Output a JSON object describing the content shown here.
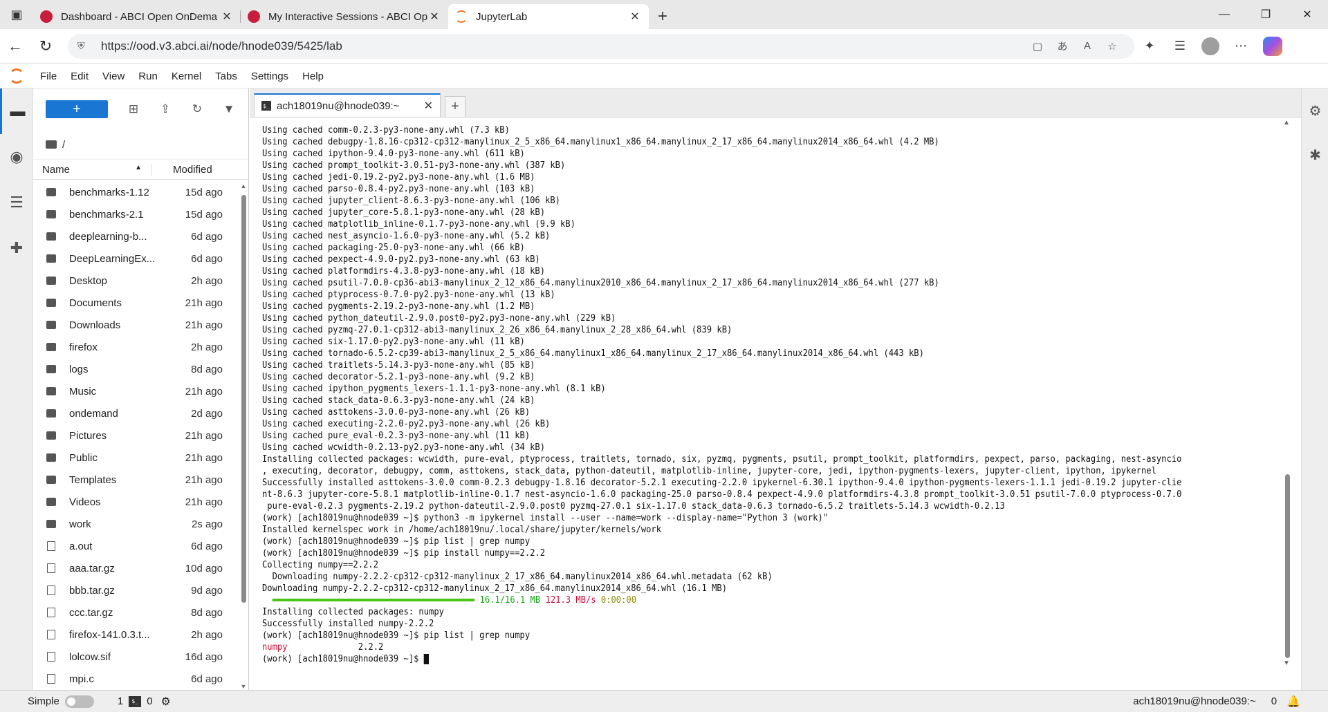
{
  "browser": {
    "tabs": [
      {
        "title": "Dashboard - ABCI Open OnDema",
        "favicon": "abci-logo-icon"
      },
      {
        "title": "My Interactive Sessions - ABCI Op",
        "favicon": "abci-logo-icon"
      },
      {
        "title": "JupyterLab",
        "favicon": "jupyter-logo-icon",
        "active": true
      }
    ],
    "url": "https://ood.v3.abci.ai/node/hnode039/5425/lab"
  },
  "menu": {
    "items": [
      "File",
      "Edit",
      "View",
      "Run",
      "Kernel",
      "Tabs",
      "Settings",
      "Help"
    ]
  },
  "filebrowser": {
    "new_label": "+",
    "crumb": "/",
    "col_name": "Name",
    "col_modified": "Modified",
    "files": [
      {
        "name": "benchmarks-1.12",
        "modified": "15d ago",
        "type": "dir"
      },
      {
        "name": "benchmarks-2.1",
        "modified": "15d ago",
        "type": "dir"
      },
      {
        "name": "deeplearning-b...",
        "modified": "6d ago",
        "type": "dir"
      },
      {
        "name": "DeepLearningEx...",
        "modified": "6d ago",
        "type": "dir"
      },
      {
        "name": "Desktop",
        "modified": "2h ago",
        "type": "dir"
      },
      {
        "name": "Documents",
        "modified": "21h ago",
        "type": "dir"
      },
      {
        "name": "Downloads",
        "modified": "21h ago",
        "type": "dir"
      },
      {
        "name": "firefox",
        "modified": "2h ago",
        "type": "dir"
      },
      {
        "name": "logs",
        "modified": "8d ago",
        "type": "dir"
      },
      {
        "name": "Music",
        "modified": "21h ago",
        "type": "dir"
      },
      {
        "name": "ondemand",
        "modified": "2d ago",
        "type": "dir"
      },
      {
        "name": "Pictures",
        "modified": "21h ago",
        "type": "dir"
      },
      {
        "name": "Public",
        "modified": "21h ago",
        "type": "dir"
      },
      {
        "name": "Templates",
        "modified": "21h ago",
        "type": "dir"
      },
      {
        "name": "Videos",
        "modified": "21h ago",
        "type": "dir"
      },
      {
        "name": "work",
        "modified": "2s ago",
        "type": "dir"
      },
      {
        "name": "a.out",
        "modified": "6d ago",
        "type": "file"
      },
      {
        "name": "aaa.tar.gz",
        "modified": "10d ago",
        "type": "file"
      },
      {
        "name": "bbb.tar.gz",
        "modified": "9d ago",
        "type": "file"
      },
      {
        "name": "ccc.tar.gz",
        "modified": "8d ago",
        "type": "file"
      },
      {
        "name": "firefox-141.0.3.t...",
        "modified": "2h ago",
        "type": "file"
      },
      {
        "name": "lolcow.sif",
        "modified": "16d ago",
        "type": "file"
      },
      {
        "name": "mpi.c",
        "modified": "6d ago",
        "type": "file"
      }
    ]
  },
  "dock": {
    "tab_label": "ach18019nu@hnode039:~",
    "tab_icon": "$_"
  },
  "terminal": {
    "lines": [
      "Using cached comm-0.2.3-py3-none-any.whl (7.3 kB)",
      "Using cached debugpy-1.8.16-cp312-cp312-manylinux_2_5_x86_64.manylinux1_x86_64.manylinux_2_17_x86_64.manylinux2014_x86_64.whl (4.2 MB)",
      "Using cached ipython-9.4.0-py3-none-any.whl (611 kB)",
      "Using cached prompt_toolkit-3.0.51-py3-none-any.whl (387 kB)",
      "Using cached jedi-0.19.2-py2.py3-none-any.whl (1.6 MB)",
      "Using cached parso-0.8.4-py2.py3-none-any.whl (103 kB)",
      "Using cached jupyter_client-8.6.3-py3-none-any.whl (106 kB)",
      "Using cached jupyter_core-5.8.1-py3-none-any.whl (28 kB)",
      "Using cached matplotlib_inline-0.1.7-py3-none-any.whl (9.9 kB)",
      "Using cached nest_asyncio-1.6.0-py3-none-any.whl (5.2 kB)",
      "Using cached packaging-25.0-py3-none-any.whl (66 kB)",
      "Using cached pexpect-4.9.0-py2.py3-none-any.whl (63 kB)",
      "Using cached platformdirs-4.3.8-py3-none-any.whl (18 kB)",
      "Using cached psutil-7.0.0-cp36-abi3-manylinux_2_12_x86_64.manylinux2010_x86_64.manylinux_2_17_x86_64.manylinux2014_x86_64.whl (277 kB)",
      "Using cached ptyprocess-0.7.0-py2.py3-none-any.whl (13 kB)",
      "Using cached pygments-2.19.2-py3-none-any.whl (1.2 MB)",
      "Using cached python_dateutil-2.9.0.post0-py2.py3-none-any.whl (229 kB)",
      "Using cached pyzmq-27.0.1-cp312-abi3-manylinux_2_26_x86_64.manylinux_2_28_x86_64.whl (839 kB)",
      "Using cached six-1.17.0-py2.py3-none-any.whl (11 kB)",
      "Using cached tornado-6.5.2-cp39-abi3-manylinux_2_5_x86_64.manylinux1_x86_64.manylinux_2_17_x86_64.manylinux2014_x86_64.whl (443 kB)",
      "Using cached traitlets-5.14.3-py3-none-any.whl (85 kB)",
      "Using cached decorator-5.2.1-py3-none-any.whl (9.2 kB)",
      "Using cached ipython_pygments_lexers-1.1.1-py3-none-any.whl (8.1 kB)",
      "Using cached stack_data-0.6.3-py3-none-any.whl (24 kB)",
      "Using cached asttokens-3.0.0-py3-none-any.whl (26 kB)",
      "Using cached executing-2.2.0-py2.py3-none-any.whl (26 kB)",
      "Using cached pure_eval-0.2.3-py3-none-any.whl (11 kB)",
      "Using cached wcwidth-0.2.13-py2.py3-none-any.whl (34 kB)",
      "Installing collected packages: wcwidth, pure-eval, ptyprocess, traitlets, tornado, six, pyzmq, pygments, psutil, prompt_toolkit, platformdirs, pexpect, parso, packaging, nest-asyncio",
      ", executing, decorator, debugpy, comm, asttokens, stack_data, python-dateutil, matplotlib-inline, jupyter-core, jedi, ipython-pygments-lexers, jupyter-client, ipython, ipykernel",
      "Successfully installed asttokens-3.0.0 comm-0.2.3 debugpy-1.8.16 decorator-5.2.1 executing-2.2.0 ipykernel-6.30.1 ipython-9.4.0 ipython-pygments-lexers-1.1.1 jedi-0.19.2 jupyter-clie",
      "nt-8.6.3 jupyter-core-5.8.1 matplotlib-inline-0.1.7 nest-asyncio-1.6.0 packaging-25.0 parso-0.8.4 pexpect-4.9.0 platformdirs-4.3.8 prompt_toolkit-3.0.51 psutil-7.0.0 ptyprocess-0.7.0",
      " pure-eval-0.2.3 pygments-2.19.2 python-dateutil-2.9.0.post0 pyzmq-27.0.1 six-1.17.0 stack_data-0.6.3 tornado-6.5.2 traitlets-5.14.3 wcwidth-0.2.13",
      "(work) [ach18019nu@hnode039 ~]$ python3 -m ipykernel install --user --name=work --display-name=\"Python 3 (work)\"",
      "Installed kernelspec work in /home/ach18019nu/.local/share/jupyter/kernels/work",
      "(work) [ach18019nu@hnode039 ~]$ pip list | grep numpy",
      "(work) [ach18019nu@hnode039 ~]$ pip install numpy==2.2.2",
      "Collecting numpy==2.2.2",
      "  Downloading numpy-2.2.2-cp312-cp312-manylinux_2_17_x86_64.manylinux2014_x86_64.whl.metadata (62 kB)",
      "Downloading numpy-2.2.2-cp312-cp312-manylinux_2_17_x86_64.manylinux2014_x86_64.whl (16.1 MB)"
    ],
    "progress": {
      "fraction": 1.0,
      "size": "16.1/16.1 MB",
      "speed": "121.3 MB/s",
      "eta": "0:00:00"
    },
    "lines_after": [
      "Installing collected packages: numpy",
      "Successfully installed numpy-2.2.2",
      "(work) [ach18019nu@hnode039 ~]$ pip list | grep numpy"
    ],
    "numpy_name": "numpy",
    "numpy_version": "2.2.2",
    "prompt": "(work) [ach18019nu@hnode039 ~]$ "
  },
  "status": {
    "mode": "Simple",
    "kernels": "1",
    "terminals": "0",
    "right_label": "ach18019nu@hnode039:~",
    "notifications": "0"
  },
  "colors": {
    "accent": "#1976d2",
    "jupyter_orange": "#f37626",
    "progress_green": "#4bc41a",
    "grep_match": "#c8143c"
  }
}
